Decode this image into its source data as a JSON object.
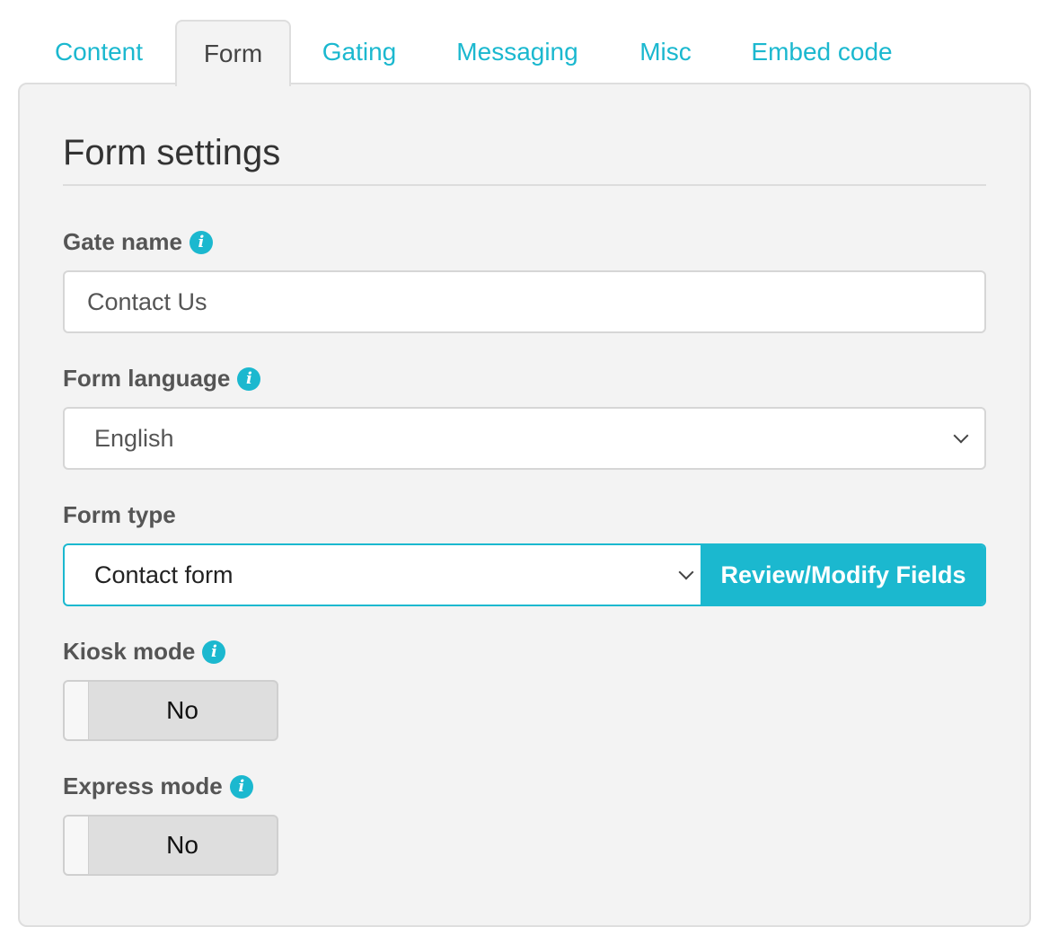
{
  "tabs": [
    {
      "label": "Content"
    },
    {
      "label": "Form"
    },
    {
      "label": "Gating"
    },
    {
      "label": "Messaging"
    },
    {
      "label": "Misc"
    },
    {
      "label": "Embed code"
    }
  ],
  "active_tab": "Form",
  "panel": {
    "title": "Form settings",
    "gate_name": {
      "label": "Gate name",
      "value": "Contact Us",
      "info_icon": "info-icon"
    },
    "form_language": {
      "label": "Form language",
      "selected": "English",
      "info_icon": "info-icon"
    },
    "form_type": {
      "label": "Form type",
      "selected": "Contact form",
      "button_label": "Review/Modify Fields"
    },
    "kiosk_mode": {
      "label": "Kiosk mode",
      "value": "No",
      "info_icon": "info-icon"
    },
    "express_mode": {
      "label": "Express mode",
      "value": "No",
      "info_icon": "info-icon"
    }
  },
  "colors": {
    "accent": "#1bb8cf",
    "panel_bg": "#f3f3f3",
    "border": "#dedede"
  }
}
